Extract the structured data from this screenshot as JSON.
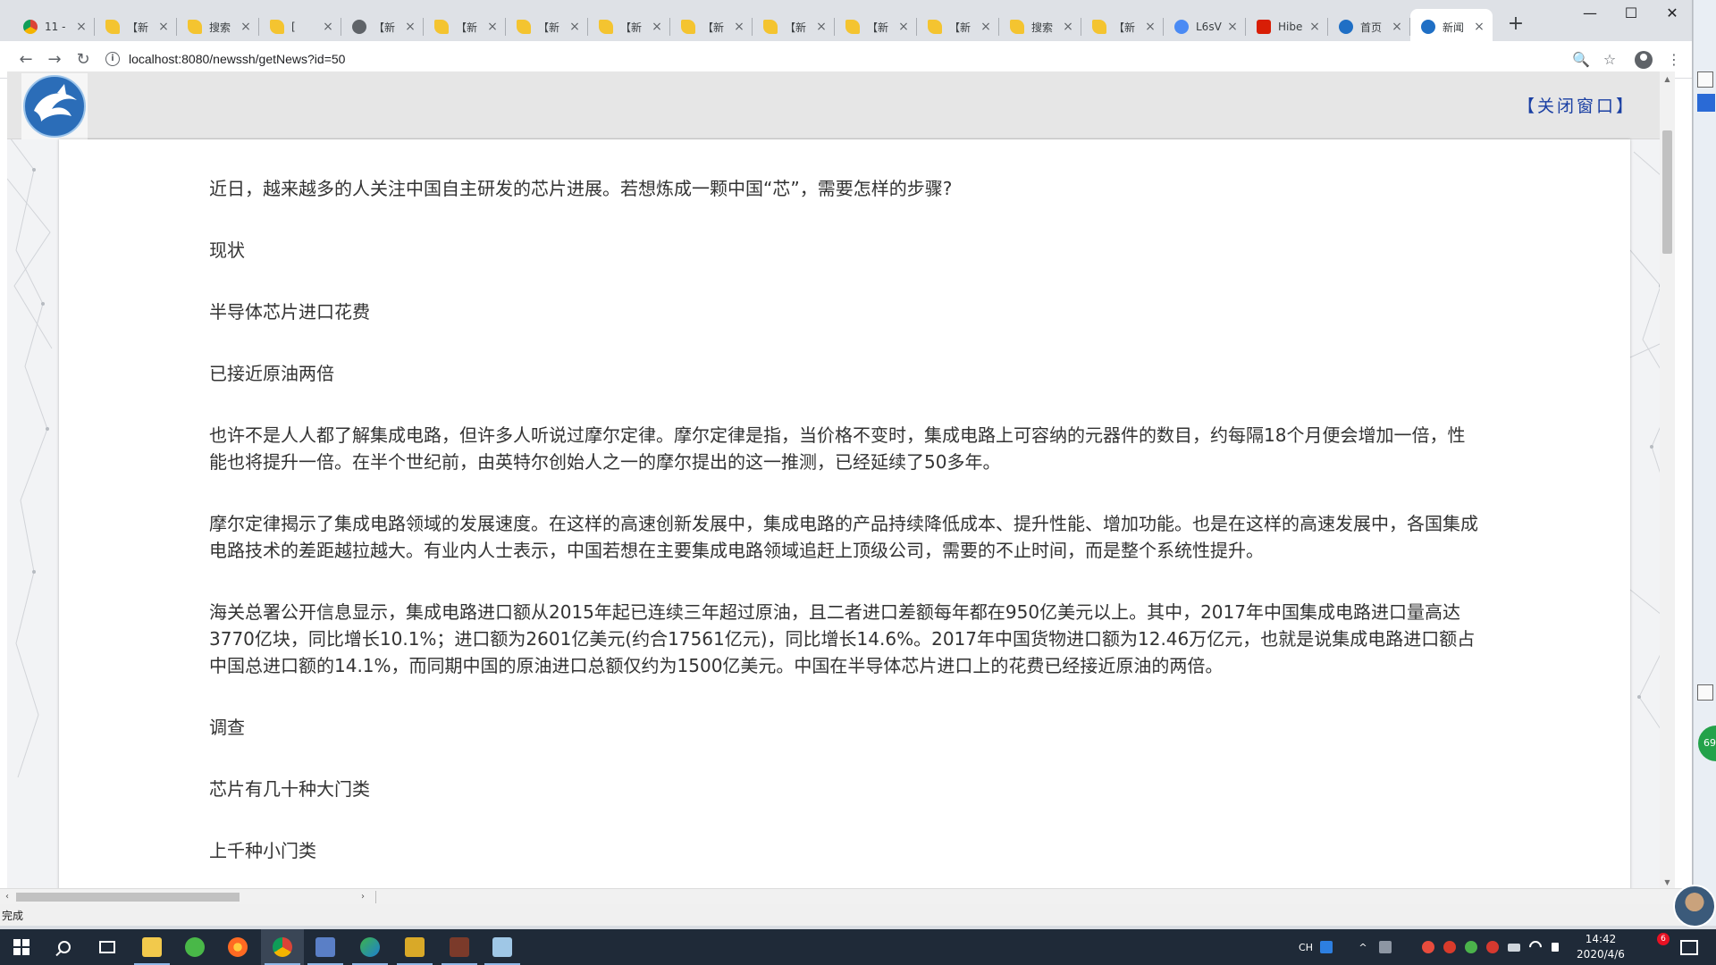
{
  "browser": {
    "tabs": [
      {
        "label": "11 -",
        "icon": "chrome-icon"
      },
      {
        "label": "【新",
        "icon": "note-icon"
      },
      {
        "label": "搜索",
        "icon": "note-icon"
      },
      {
        "label": "[",
        "icon": "note-icon"
      },
      {
        "label": "【新",
        "icon": "globe-icon"
      },
      {
        "label": "【新",
        "icon": "note-icon"
      },
      {
        "label": "【新",
        "icon": "note-icon"
      },
      {
        "label": "【新",
        "icon": "note-icon"
      },
      {
        "label": "【新",
        "icon": "note-icon"
      },
      {
        "label": "【新",
        "icon": "note-icon"
      },
      {
        "label": "【新",
        "icon": "note-icon"
      },
      {
        "label": "【新",
        "icon": "note-icon"
      },
      {
        "label": "搜索",
        "icon": "note-icon"
      },
      {
        "label": "【新",
        "icon": "note-icon"
      },
      {
        "label": "L6sV",
        "icon": "gear-icon"
      },
      {
        "label": "Hibe",
        "icon": "c-logo-icon"
      },
      {
        "label": "首页",
        "icon": "edge-icon"
      },
      {
        "label": "新闻",
        "icon": "edge-icon",
        "active": true
      }
    ],
    "tab_close_glyph": "×",
    "newtab_glyph": "+",
    "window_controls": {
      "minimize": "—",
      "maximize": "☐",
      "close": "✕"
    },
    "nav": {
      "back": "←",
      "forward": "→",
      "reload": "↻"
    },
    "url": "localhost:8080/newssh/getNews?id=50",
    "info_glyph": "i",
    "zoom_glyph": "🔍",
    "star_glyph": "☆",
    "menu_glyph": "⋮",
    "status_text": "完成"
  },
  "page": {
    "close_window": "【关闭窗口】",
    "paragraphs": [
      "近日，越来越多的人关注中国自主研发的芯片进展。若想炼成一颗中国“芯”，需要怎样的步骤?",
      "现状",
      "半导体芯片进口花费",
      "已接近原油两倍",
      "也许不是人人都了解集成电路，但许多人听说过摩尔定律。摩尔定律是指，当价格不变时，集成电路上可容纳的元器件的数目，约每隔18个月便会增加一倍，性能也将提升一倍。在半个世纪前，由英特尔创始人之一的摩尔提出的这一推测，已经延续了50多年。",
      "摩尔定律揭示了集成电路领域的发展速度。在这样的高速创新发展中，集成电路的产品持续降低成本、提升性能、增加功能。也是在这样的高速发展中，各国集成电路技术的差距越拉越大。有业内人士表示，中国若想在主要集成电路领域追赶上顶级公司，需要的不止时间，而是整个系统性提升。",
      "海关总署公开信息显示，集成电路进口额从2015年起已连续三年超过原油，且二者进口差额每年都在950亿美元以上。其中，2017年中国集成电路进口量高达3770亿块，同比增长10.1%；进口额为2601亿美元(约合17561亿元)，同比增长14.6%。2017年中国货物进口额为12.46万亿元，也就是说集成电路进口额占中国总进口额的14.1%，而同期中国的原油进口总额仅约为1500亿美元。中国在半导体芯片进口上的花费已经接近原油的两倍。",
      "调查",
      "芯片有几十种大门类",
      "上千种小门类"
    ]
  },
  "side": {
    "badge_text": "69"
  },
  "taskbar": {
    "clock_time": "14:42",
    "clock_date": "2020/4/6",
    "ime_label": "CH",
    "notification_count": "6"
  },
  "colors": {
    "link": "#1a3fa3",
    "text": "#333333",
    "taskbar": "#1f2a38"
  }
}
